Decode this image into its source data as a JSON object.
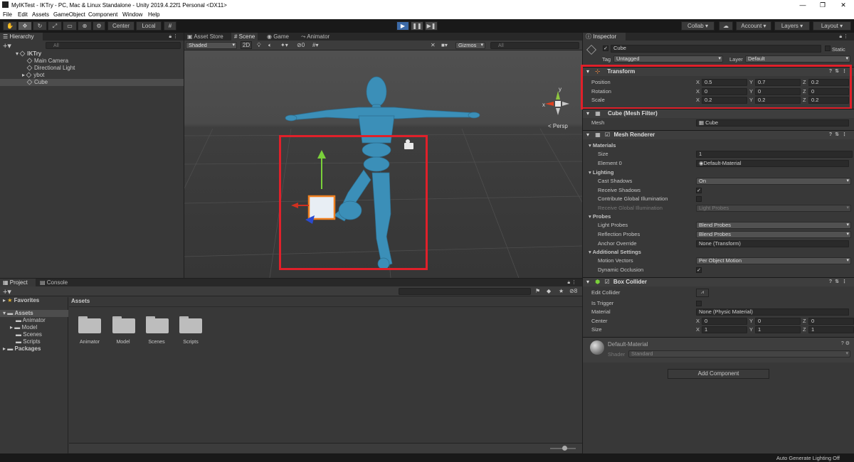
{
  "window": {
    "title": "MyIKTest - IKTry - PC, Mac & Linux Standalone - Unity 2019.4.22f1 Personal <DX11>"
  },
  "menu": [
    "File",
    "Edit",
    "Assets",
    "GameObject",
    "Component",
    "Window",
    "Help"
  ],
  "toolbar": {
    "pivot": "Center",
    "space": "Local",
    "collab": "Collab",
    "account": "Account",
    "layers": "Layers",
    "layout": "Layout"
  },
  "hierarchy": {
    "tab": "Hierarchy",
    "search_placeholder": "All",
    "scene": "IKTry",
    "items": [
      "Main Camera",
      "Directional Light",
      "ybot",
      "Cube"
    ]
  },
  "scene_view": {
    "tabs": [
      "Asset Store",
      "Scene",
      "Game",
      "Animator"
    ],
    "selected_tab": "Scene",
    "draw_mode": "Shaded",
    "mode_2d": "2D",
    "gizmos": "Gizmos",
    "search_placeholder": "All",
    "fx_count": "0",
    "persp_label": "< Persp",
    "axis_x": "x",
    "axis_y": "y"
  },
  "project": {
    "tabs": [
      "Project",
      "Console"
    ],
    "tree": {
      "favorites": "Favorites",
      "assets": "Assets",
      "children": [
        "Animator",
        "Model",
        "Scenes",
        "Scripts"
      ],
      "packages": "Packages"
    },
    "breadcrumb": "Assets",
    "folders": [
      "Animator",
      "Model",
      "Scenes",
      "Scripts"
    ],
    "hidden_count": "8"
  },
  "inspector": {
    "tab": "Inspector",
    "object_name": "Cube",
    "static_label": "Static",
    "tag_label": "Tag",
    "tag_value": "Untagged",
    "layer_label": "Layer",
    "layer_value": "Default",
    "transform": {
      "title": "Transform",
      "rows": [
        {
          "label": "Position",
          "x": "0.5",
          "y": "0.7",
          "z": "0.2"
        },
        {
          "label": "Rotation",
          "x": "0",
          "y": "0",
          "z": "0"
        },
        {
          "label": "Scale",
          "x": "0.2",
          "y": "0.2",
          "z": "0.2"
        }
      ]
    },
    "mesh_filter": {
      "title": "Cube (Mesh Filter)",
      "mesh_label": "Mesh",
      "mesh_value": "Cube"
    },
    "mesh_renderer": {
      "title": "Mesh Renderer",
      "materials": "Materials",
      "size_label": "Size",
      "size_value": "1",
      "element_label": "Element 0",
      "element_value": "Default-Material",
      "lighting": "Lighting",
      "cast_shadows_label": "Cast Shadows",
      "cast_shadows_value": "On",
      "receive_shadows_label": "Receive Shadows",
      "contribute_gi_label": "Contribute Global Illumination",
      "receive_gi_label": "Receive Global Illumination",
      "receive_gi_value": "Light Probes",
      "probes": "Probes",
      "light_probes_label": "Light Probes",
      "light_probes_value": "Blend Probes",
      "reflection_probes_label": "Reflection Probes",
      "reflection_probes_value": "Blend Probes",
      "anchor_label": "Anchor Override",
      "anchor_value": "None (Transform)",
      "additional": "Additional Settings",
      "motion_vectors_label": "Motion Vectors",
      "motion_vectors_value": "Per Object Motion",
      "dynamic_occlusion_label": "Dynamic Occlusion"
    },
    "box_collider": {
      "title": "Box Collider",
      "edit_label": "Edit Collider",
      "trigger_label": "Is Trigger",
      "material_label": "Material",
      "material_value": "None (Physic Material)",
      "center_label": "Center",
      "center": {
        "x": "0",
        "y": "0",
        "z": "0"
      },
      "size_label": "Size",
      "size": {
        "x": "1",
        "y": "1",
        "z": "1"
      }
    },
    "material": {
      "name": "Default-Material",
      "shader_label": "Shader",
      "shader_value": "Standard"
    },
    "add_component": "Add Component"
  },
  "statusbar": {
    "text": "Auto Generate Lighting Off"
  },
  "colors": {
    "selection_box": "#e0202a",
    "robot": "#3b8fb8",
    "play_active": "#3c6aa8"
  }
}
